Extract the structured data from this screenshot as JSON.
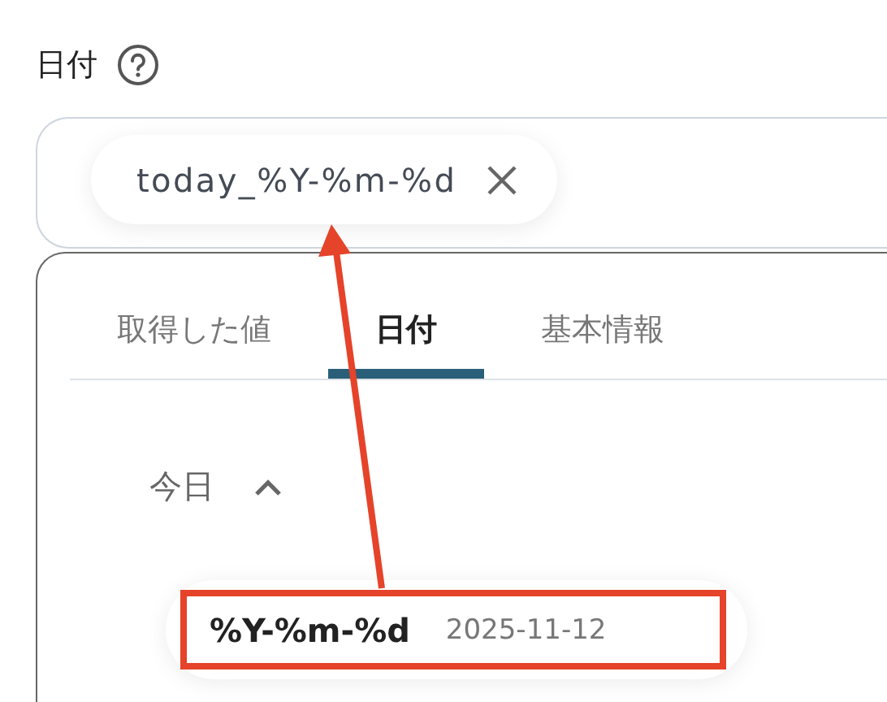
{
  "field": {
    "label": "日付",
    "chip": {
      "text": "today_%Y-%m-%d"
    }
  },
  "tabs": [
    {
      "label": "取得した値",
      "selected": false
    },
    {
      "label": "日付",
      "selected": true
    },
    {
      "label": "基本情報",
      "selected": false
    }
  ],
  "section": {
    "title": "今日",
    "expanded": true
  },
  "items": [
    {
      "format": "%Y-%m-%d",
      "example": "2025-11-12",
      "highlighted": true
    }
  ]
}
